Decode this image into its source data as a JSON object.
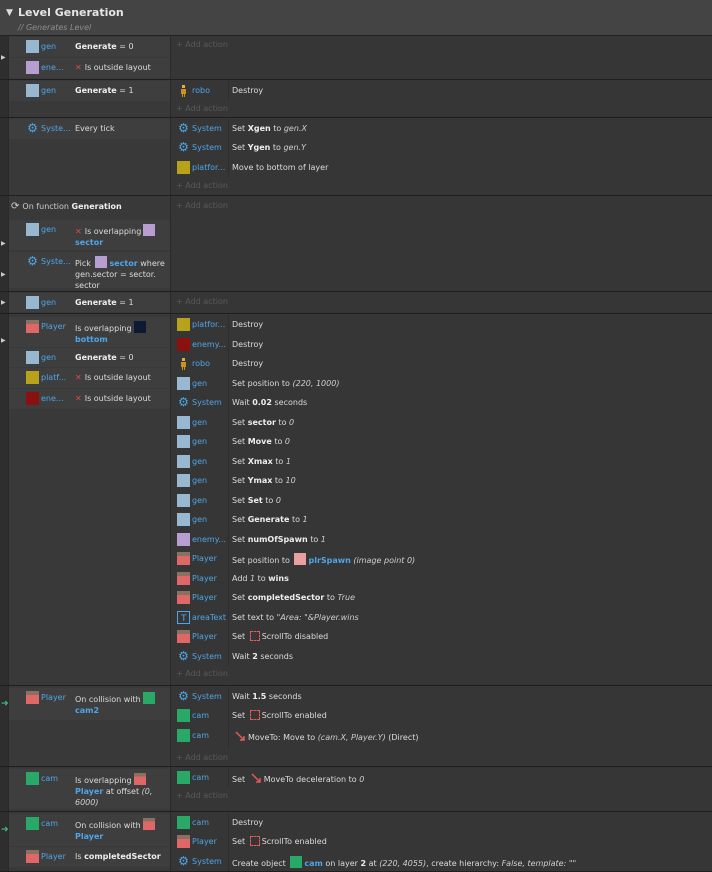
{
  "group": {
    "title": "Level Generation",
    "description": "Generates Level"
  },
  "add_action_label": "Add action",
  "colors": {
    "gen": "#97b8d0",
    "enemy": "#b79ed0",
    "player": "#e06767",
    "platform": "#b8a21c",
    "enemy_red": "#8b1010",
    "cam": "#2aa868",
    "bottom": "#0d1a33",
    "sector": "#b79ed0",
    "plrspawn": "#e8a0a0",
    "link": "#4fa5e8"
  },
  "functions": {
    "on_function": "On function",
    "name": "Generation"
  },
  "events": [
    {
      "conditions": [
        {
          "object": "gen",
          "icon": "gen",
          "parts": [
            {
              "t": "Generate",
              "c": "b"
            },
            {
              "t": " = 0"
            }
          ]
        },
        {
          "object": "ene...",
          "icon": "enemy",
          "parts": [
            {
              "t": "✕",
              "c": "xr"
            },
            {
              "t": "Is outside layout"
            }
          ]
        }
      ],
      "actions": []
    },
    {
      "conditions": [
        {
          "object": "gen",
          "icon": "gen",
          "parts": [
            {
              "t": "Generate",
              "c": "b"
            },
            {
              "t": " = 1"
            }
          ]
        }
      ],
      "actions": [
        {
          "object": "robo",
          "icon": "robo",
          "parts": [
            {
              "t": "Destroy"
            }
          ]
        }
      ]
    },
    {
      "conditions": [
        {
          "object": "Syste...",
          "icon": "system",
          "parts": [
            {
              "t": "Every tick"
            }
          ]
        }
      ],
      "actions": [
        {
          "object": "System",
          "icon": "system",
          "parts": [
            {
              "t": "Set "
            },
            {
              "t": "Xgen",
              "c": "b"
            },
            {
              "t": " to "
            },
            {
              "t": "gen.X",
              "c": "i"
            }
          ]
        },
        {
          "object": "System",
          "icon": "system",
          "parts": [
            {
              "t": "Set "
            },
            {
              "t": "Ygen",
              "c": "b"
            },
            {
              "t": " to "
            },
            {
              "t": "gen.Y",
              "c": "i"
            }
          ]
        },
        {
          "object": "platfor...",
          "icon": "platform",
          "parts": [
            {
              "t": "Move to bottom of layer"
            }
          ]
        }
      ]
    },
    {
      "conditions": [
        {
          "object": "gen",
          "icon": "gen",
          "parts": [
            {
              "t": "✕",
              "c": "xr"
            },
            {
              "t": "Is overlapping"
            },
            {
              "t": "",
              "icon": "sector"
            },
            {
              "t": "sector",
              "c": "hl"
            }
          ]
        },
        {
          "object": "Syste...",
          "icon": "system",
          "parts": [
            {
              "t": "Pick "
            },
            {
              "t": "",
              "icon": "sector"
            },
            {
              "t": "sector",
              "c": "hl"
            },
            {
              "t": " where gen.sector = sector. sector"
            }
          ]
        }
      ],
      "actions": []
    },
    {
      "conditions": [
        {
          "object": "gen",
          "icon": "gen",
          "parts": [
            {
              "t": "Generate",
              "c": "b"
            },
            {
              "t": " = 1"
            }
          ]
        }
      ],
      "actions": []
    },
    {
      "conditions": [
        {
          "object": "Player",
          "icon": "player",
          "parts": [
            {
              "t": "Is overlapping"
            },
            {
              "t": "",
              "icon": "bottom"
            },
            {
              "t": "bottom",
              "c": "hl"
            }
          ]
        },
        {
          "object": "gen",
          "icon": "gen",
          "parts": [
            {
              "t": "Generate",
              "c": "b"
            },
            {
              "t": " = 0"
            }
          ]
        },
        {
          "object": "platf...",
          "icon": "platform",
          "parts": [
            {
              "t": "✕",
              "c": "xr"
            },
            {
              "t": "Is outside layout"
            }
          ]
        },
        {
          "object": "ene...",
          "icon": "enemy_red",
          "parts": [
            {
              "t": "✕",
              "c": "xr"
            },
            {
              "t": "Is outside layout"
            }
          ]
        }
      ],
      "actions": [
        {
          "object": "platfor...",
          "icon": "platform",
          "parts": [
            {
              "t": "Destroy"
            }
          ]
        },
        {
          "object": "enemy...",
          "icon": "enemy_red",
          "parts": [
            {
              "t": "Destroy"
            }
          ]
        },
        {
          "object": "robo",
          "icon": "robo",
          "parts": [
            {
              "t": "Destroy"
            }
          ]
        },
        {
          "object": "gen",
          "icon": "gen",
          "parts": [
            {
              "t": "Set position to "
            },
            {
              "t": "(220, 1000)",
              "c": "i"
            }
          ]
        },
        {
          "object": "System",
          "icon": "system",
          "parts": [
            {
              "t": "Wait "
            },
            {
              "t": "0.02",
              "c": "b"
            },
            {
              "t": " seconds"
            }
          ]
        },
        {
          "object": "gen",
          "icon": "gen",
          "parts": [
            {
              "t": "Set "
            },
            {
              "t": "sector",
              "c": "b"
            },
            {
              "t": " to "
            },
            {
              "t": "0",
              "c": "i"
            }
          ]
        },
        {
          "object": "gen",
          "icon": "gen",
          "parts": [
            {
              "t": "Set "
            },
            {
              "t": "Move",
              "c": "b"
            },
            {
              "t": " to "
            },
            {
              "t": "0",
              "c": "i"
            }
          ]
        },
        {
          "object": "gen",
          "icon": "gen",
          "parts": [
            {
              "t": "Set "
            },
            {
              "t": "Xmax",
              "c": "b"
            },
            {
              "t": " to "
            },
            {
              "t": "1",
              "c": "i"
            }
          ]
        },
        {
          "object": "gen",
          "icon": "gen",
          "parts": [
            {
              "t": "Set "
            },
            {
              "t": "Ymax",
              "c": "b"
            },
            {
              "t": " to "
            },
            {
              "t": "10",
              "c": "i"
            }
          ]
        },
        {
          "object": "gen",
          "icon": "gen",
          "parts": [
            {
              "t": "Set "
            },
            {
              "t": "Set",
              "c": "b"
            },
            {
              "t": " to "
            },
            {
              "t": "0",
              "c": "i"
            }
          ]
        },
        {
          "object": "gen",
          "icon": "gen",
          "parts": [
            {
              "t": "Set "
            },
            {
              "t": "Generate",
              "c": "b"
            },
            {
              "t": " to "
            },
            {
              "t": "1",
              "c": "i"
            }
          ]
        },
        {
          "object": "enemy...",
          "icon": "enemy",
          "parts": [
            {
              "t": "Set "
            },
            {
              "t": "numOfSpawn",
              "c": "b"
            },
            {
              "t": " to "
            },
            {
              "t": "1",
              "c": "i"
            }
          ]
        },
        {
          "object": "Player",
          "icon": "player",
          "parts": [
            {
              "t": "Set position to "
            },
            {
              "t": "",
              "icon": "plrspawn"
            },
            {
              "t": "plrSpawn",
              "c": "hl"
            },
            {
              "t": " (image point 0)",
              "c": "i"
            }
          ]
        },
        {
          "object": "Player",
          "icon": "player",
          "parts": [
            {
              "t": "Add "
            },
            {
              "t": "1",
              "c": "i"
            },
            {
              "t": " to "
            },
            {
              "t": "wins",
              "c": "b"
            }
          ]
        },
        {
          "object": "Player",
          "icon": "player",
          "parts": [
            {
              "t": "Set "
            },
            {
              "t": "completedSector",
              "c": "b"
            },
            {
              "t": " to "
            },
            {
              "t": "True",
              "c": "i"
            }
          ]
        },
        {
          "object": "areaText",
          "icon": "text",
          "parts": [
            {
              "t": "Set text to "
            },
            {
              "t": "\"Area: \"&Player.wins",
              "c": "i"
            }
          ]
        },
        {
          "object": "Player",
          "icon": "player",
          "parts": [
            {
              "t": "Set "
            },
            {
              "t": "",
              "icon": "scroll"
            },
            {
              "t": "ScrollTo disabled"
            }
          ]
        },
        {
          "object": "System",
          "icon": "system",
          "parts": [
            {
              "t": "Wait "
            },
            {
              "t": "2",
              "c": "b"
            },
            {
              "t": " seconds"
            }
          ]
        }
      ]
    },
    {
      "conditions": [
        {
          "object": "Player",
          "icon": "player",
          "parts": [
            {
              "t": "On collision with"
            },
            {
              "t": "",
              "icon": "cam"
            },
            {
              "t": "cam2",
              "c": "hl"
            }
          ]
        }
      ],
      "actions": [
        {
          "object": "System",
          "icon": "system",
          "parts": [
            {
              "t": "Wait "
            },
            {
              "t": "1.5",
              "c": "b"
            },
            {
              "t": " seconds"
            }
          ]
        },
        {
          "object": "cam",
          "icon": "cam",
          "parts": [
            {
              "t": "Set "
            },
            {
              "t": "",
              "icon": "scroll"
            },
            {
              "t": "ScrollTo enabled"
            }
          ]
        },
        {
          "object": "cam",
          "icon": "cam",
          "parts": [
            {
              "t": "",
              "icon": "moveto"
            },
            {
              "t": "MoveTo: Move to "
            },
            {
              "t": "(cam.X, Player.Y)",
              "c": "i"
            },
            {
              "t": " (Direct)"
            }
          ]
        }
      ]
    },
    {
      "conditions": [
        {
          "object": "cam",
          "icon": "cam",
          "parts": [
            {
              "t": "Is overlapping"
            },
            {
              "t": "",
              "icon": "player"
            },
            {
              "t": "Player",
              "c": "hl"
            },
            {
              "t": " at offset "
            },
            {
              "t": "(0, 6000)",
              "c": "i"
            }
          ]
        }
      ],
      "actions": [
        {
          "object": "cam",
          "icon": "cam",
          "parts": [
            {
              "t": "Set "
            },
            {
              "t": "",
              "icon": "moveto"
            },
            {
              "t": "MoveTo deceleration to "
            },
            {
              "t": "0",
              "c": "i"
            }
          ]
        }
      ]
    },
    {
      "conditions": [
        {
          "object": "cam",
          "icon": "cam",
          "parts": [
            {
              "t": "On collision with"
            },
            {
              "t": "",
              "icon": "player"
            },
            {
              "t": "Player",
              "c": "hl"
            }
          ]
        },
        {
          "object": "Player",
          "icon": "player",
          "parts": [
            {
              "t": "Is "
            },
            {
              "t": "completedSector",
              "c": "b"
            }
          ]
        }
      ],
      "actions": [
        {
          "object": "cam",
          "icon": "cam",
          "parts": [
            {
              "t": "Destroy"
            }
          ]
        },
        {
          "object": "Player",
          "icon": "player",
          "parts": [
            {
              "t": "Set "
            },
            {
              "t": "",
              "icon": "scroll"
            },
            {
              "t": "ScrollTo enabled"
            }
          ]
        },
        {
          "object": "System",
          "icon": "system",
          "parts": [
            {
              "t": "Create object "
            },
            {
              "t": "",
              "icon": "cam"
            },
            {
              "t": "cam",
              "c": "hl"
            },
            {
              "t": " on layer "
            },
            {
              "t": "2",
              "c": "b"
            },
            {
              "t": " at "
            },
            {
              "t": "(220, 4055)",
              "c": "i"
            },
            {
              "t": ", create hierarchy: "
            },
            {
              "t": "False",
              "c": "i"
            },
            {
              "t": ", template: \"\"",
              "c": "i"
            }
          ]
        }
      ]
    }
  ]
}
